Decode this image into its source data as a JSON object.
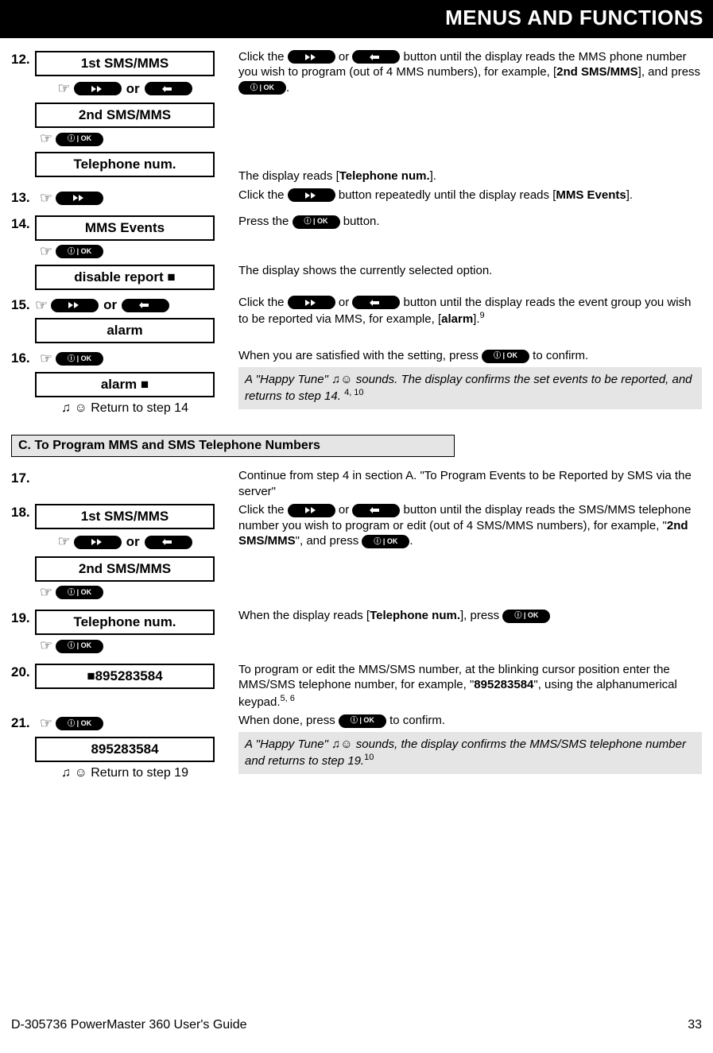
{
  "header": "MENUS AND FUNCTIONS",
  "steps": {
    "s12": {
      "num": "12.",
      "d1": "1st SMS/MMS",
      "d2": "2nd SMS/MMS",
      "d3": "Telephone num.",
      "desc1a": "Click the ",
      "desc1b": " or ",
      "desc1c": " button until the display reads the MMS phone number you wish to program (out of 4 MMS numbers), for example, [",
      "desc1d": "2nd SMS/MMS",
      "desc1e": "], and press ",
      "desc1f": ".",
      "desc2a": "The display reads [",
      "desc2b": "Telephone num.",
      "desc2c": "]."
    },
    "s13": {
      "num": "13.",
      "desc_a": "Click the ",
      "desc_b": " button repeatedly until the display reads [",
      "desc_c": "MMS Events",
      "desc_d": "]."
    },
    "s14": {
      "num": "14.",
      "d1": "MMS Events",
      "d2": "disable report ■",
      "desc_a": "Press the ",
      "desc_b": " button.",
      "desc2": "The display shows the currently selected option."
    },
    "s15": {
      "num": "15.",
      "d1": "alarm",
      "desc_a": "Click the ",
      "desc_b": " or ",
      "desc_c": " button until the display reads the event group you wish to be reported via MMS, for example, [",
      "desc_d": "alarm",
      "desc_e": "].",
      "sup": "9"
    },
    "s16": {
      "num": "16.",
      "d1": "alarm ■",
      "return": "☺ Return to step 14",
      "desc_a": "When you are satisfied with the setting, press ",
      "desc_b": " to confirm.",
      "note_a": "A \"Happy Tune\" ",
      "note_b": "☺ sounds. The display confirms the set events to be reported, and returns to step 14. ",
      "sup": "4, 10"
    },
    "sectionC": "C. To Program MMS and SMS Telephone Numbers",
    "s17": {
      "num": "17.",
      "desc": "Continue from step 4 in section A. \"To Program Events to be Reported by SMS via the server\""
    },
    "s18": {
      "num": "18.",
      "d1": "1st SMS/MMS",
      "d2": "2nd SMS/MMS",
      "desc_a": "Click the ",
      "desc_b": " or ",
      "desc_c": " button until the display reads the SMS/MMS telephone number you wish to program or edit (out of 4 SMS/MMS numbers), for example, \"",
      "desc_d": "2nd SMS/MMS",
      "desc_e": "\", and press ",
      "desc_f": "."
    },
    "s19": {
      "num": "19.",
      "d1": "Telephone num.",
      "desc_a": "When the display reads [",
      "desc_b": "Telephone num.",
      "desc_c": "], press "
    },
    "s20": {
      "num": "20.",
      "d1": "■895283584",
      "desc_a": "To program or edit the MMS/SMS number, at the blinking cursor position enter the MMS/SMS telephone number, for example, \"",
      "desc_b": "895283584",
      "desc_c": "\", using the alphanumerical keypad.",
      "sup": "5, 6"
    },
    "s21": {
      "num": "21.",
      "d1": "895283584",
      "return": "☺ Return to step 19",
      "desc_a": "When done, press ",
      "desc_b": " to confirm.",
      "note_a": "A \"Happy Tune\" ",
      "note_b": "☺ sounds, the display confirms the MMS/SMS telephone number and returns to step 19.",
      "sup": "10"
    }
  },
  "or": "or",
  "footer_left": "D-305736 PowerMaster 360 User's Guide",
  "footer_right": "33"
}
